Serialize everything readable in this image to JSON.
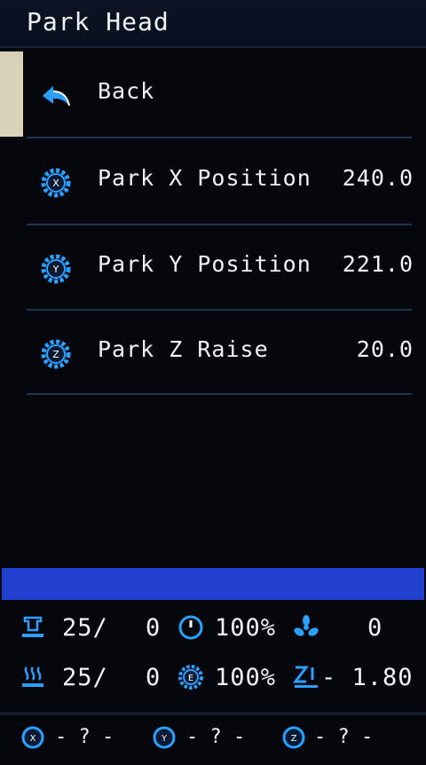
{
  "header": {
    "title": "Park Head"
  },
  "menu": {
    "items": [
      {
        "label": "Back",
        "value": "",
        "icon": "back-arrow-icon"
      },
      {
        "label": "Park X Position",
        "value": "240.0",
        "icon": "x-gear-icon"
      },
      {
        "label": "Park Y Position",
        "value": "221.0",
        "icon": "y-gear-icon"
      },
      {
        "label": "Park Z Raise",
        "value": "20.0",
        "icon": "z-gear-icon"
      }
    ]
  },
  "status": {
    "bed_current": "25/",
    "bed_target": "0",
    "feedrate": "100%",
    "fan": "0",
    "hotend_current": "25/",
    "hotend_target": "0",
    "flow": "100%",
    "z_offset": "- 1.80"
  },
  "axes": {
    "x": "- ? -",
    "y": "- ? -",
    "z": "- ? -"
  },
  "colors": {
    "accent": "#2aa0ff",
    "progress": "#1f3fcf",
    "selection": "#d9d2b8"
  }
}
